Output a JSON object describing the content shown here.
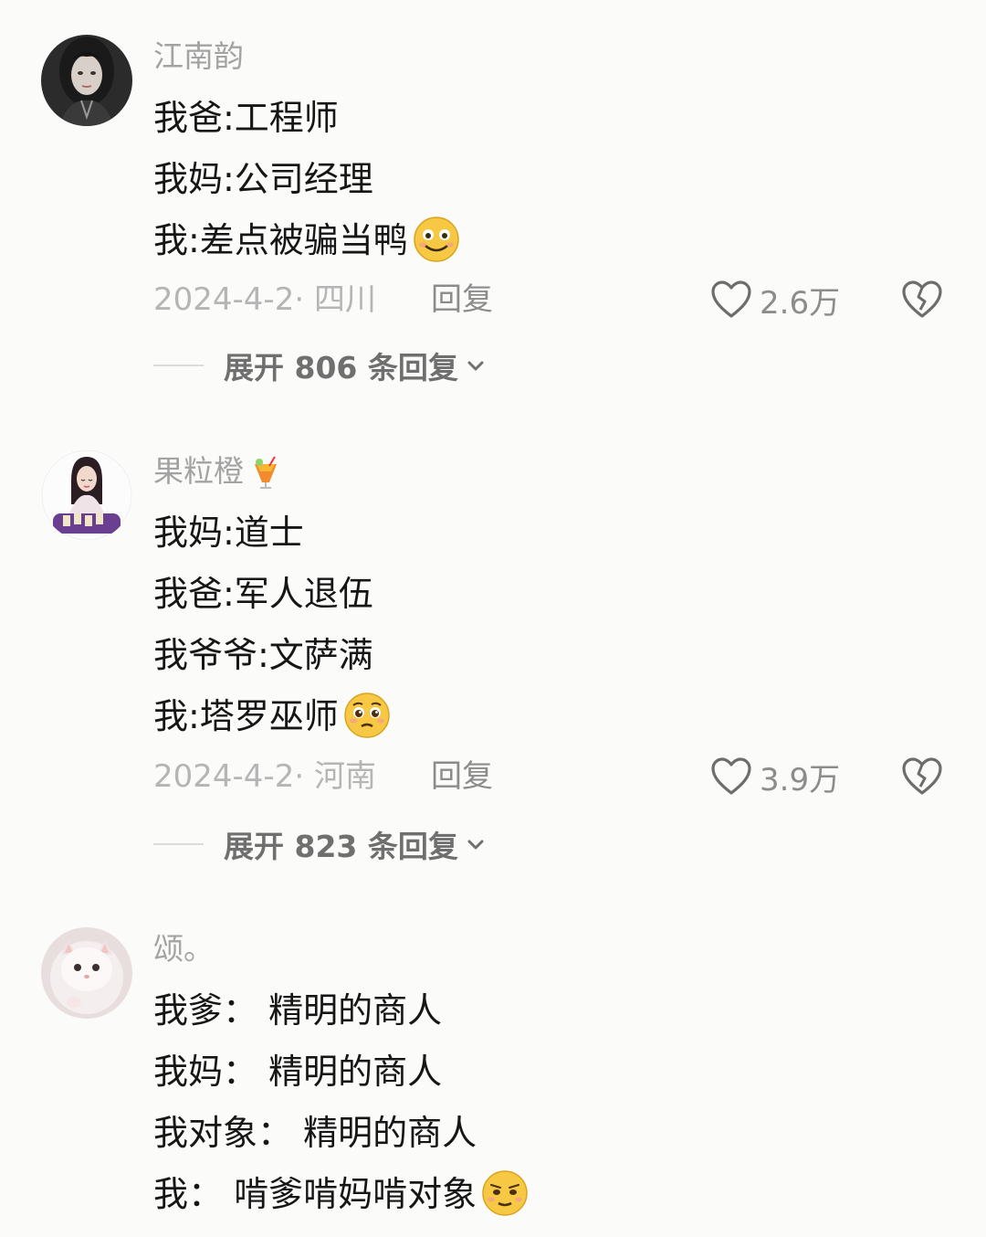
{
  "comments": [
    {
      "username": "江南韵",
      "lines": [
        "我爸:工程师",
        "我妈:公司经理",
        "我:差点被骗当鸭"
      ],
      "date": "2024-4-2· 四川",
      "reply": "回复",
      "likes": "2.6万",
      "expand": "展开 806 条回复"
    },
    {
      "username": "果粒橙",
      "lines": [
        "我妈:道士",
        "我爸:军人退伍",
        "我爷爷:文萨满",
        "我:塔罗巫师"
      ],
      "date": "2024-4-2· 河南",
      "reply": "回复",
      "likes": "3.9万",
      "expand": "展开 823 条回复"
    },
    {
      "username": "颂。",
      "lines": [
        "我爹： 精明的商人",
        "我妈： 精明的商人",
        "我对象： 精明的商人",
        "我： 啃爹啃妈啃对象"
      ]
    }
  ],
  "icons": {
    "like": "heart-outline-icon",
    "dislike": "broken-heart-icon",
    "expand": "chevron-down-icon",
    "emoji_1": "smile-emoji",
    "emoji_2": "pleading-emoji",
    "emoji_3": "smirk-emoji",
    "badge": "tropical-drink-icon"
  },
  "colors": {
    "background": "#fbfbfa",
    "text": "#161616",
    "muted": "#a3a3a3",
    "secondary": "#8c8c8c"
  }
}
